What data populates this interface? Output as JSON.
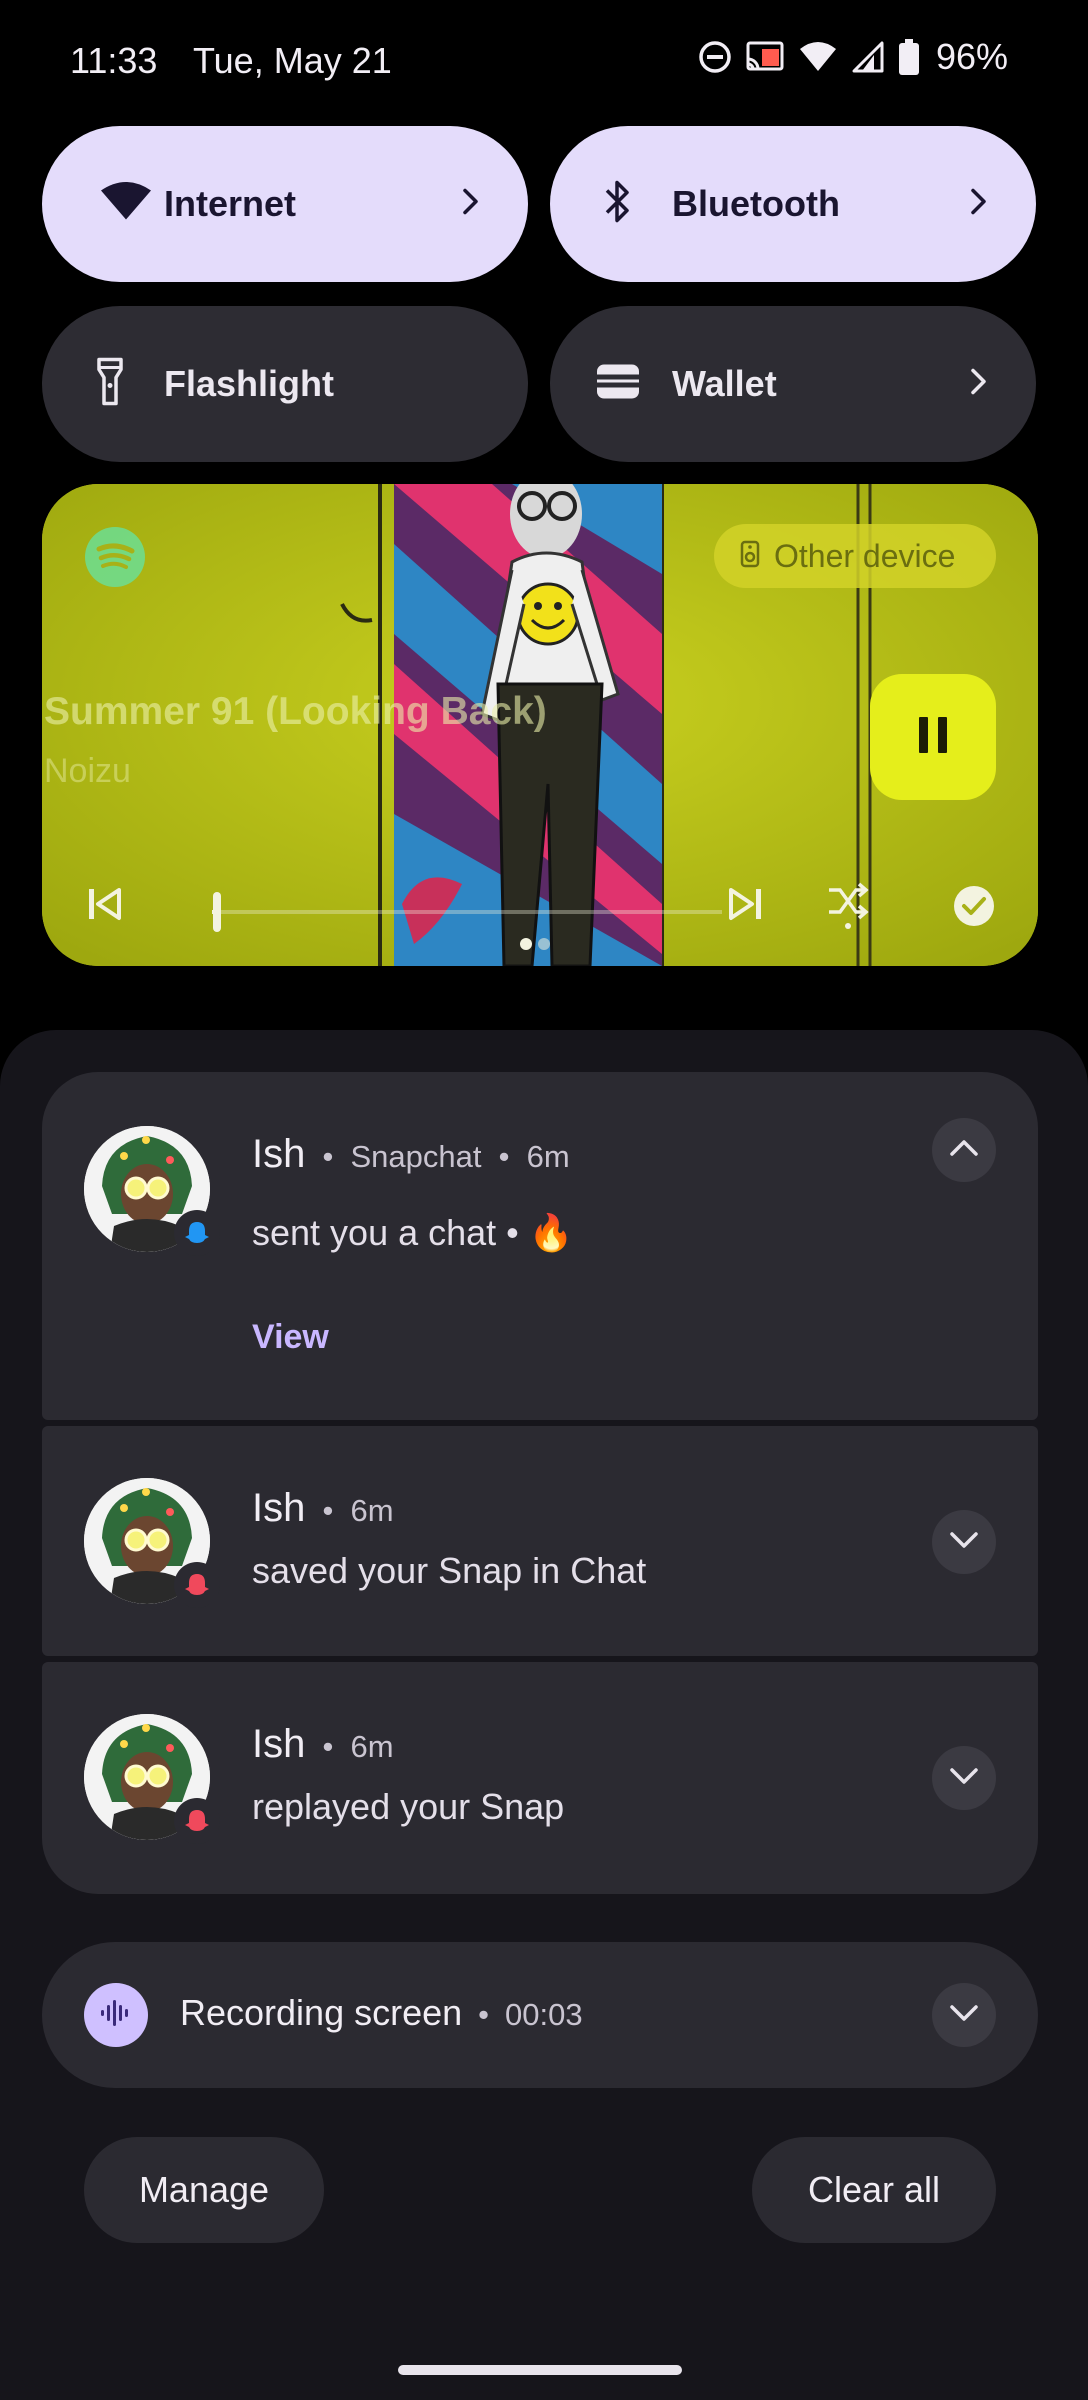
{
  "status_bar": {
    "time": "11:33",
    "date": "Tue, May 21",
    "battery": "96%"
  },
  "tiles": {
    "internet": "Internet",
    "bluetooth": "Bluetooth",
    "flashlight": "Flashlight",
    "wallet": "Wallet"
  },
  "media": {
    "app_icon": "spotify-icon",
    "output_device": "Other device",
    "track_title": "Summer 91 (Looking Back)",
    "artist": "Noizu",
    "progress": 0.01,
    "page_count": 2,
    "active_page": 1
  },
  "notifications": [
    {
      "sender": "Ish",
      "app": "Snapchat",
      "time": "6m",
      "body": "sent you a chat • 🔥",
      "action": "View",
      "badge_color": "#2196f3",
      "expanded": true
    },
    {
      "sender": "Ish",
      "time": "6m",
      "body": "saved your Snap in Chat",
      "badge_color": "#f0495c",
      "expanded": false
    },
    {
      "sender": "Ish",
      "time": "6m",
      "body": "replayed your Snap",
      "badge_color": "#f0495c",
      "expanded": false
    }
  ],
  "recording": {
    "title": "Recording screen",
    "timer": "00:03"
  },
  "buttons": {
    "manage": "Manage",
    "clear_all": "Clear all"
  },
  "separator": "•"
}
